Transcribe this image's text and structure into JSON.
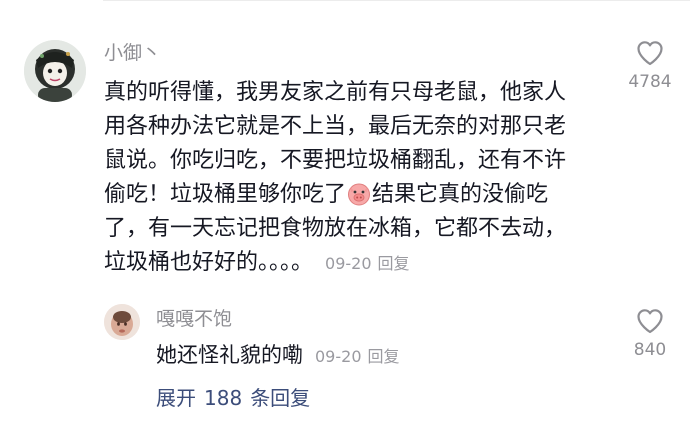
{
  "main_comment": {
    "username": "小御丶",
    "lines": [
      "真的听得懂，我男友家之前有只母老鼠，他家人",
      "用各种办法它就是不上当，最后无奈的对那只老",
      "鼠说。你吃归吃，不要把垃圾桶翻乱，还有不许",
      "偷吃！垃圾桶里够你吃了",
      "了，有一天忘记把食物放在冰箱，它都不去动，",
      "垃圾桶也好好的。。。。"
    ],
    "line4_after_emoji": "结果它真的没偷吃",
    "emoji": "pig-face-icon",
    "date": "09-20",
    "reply_label": "回复",
    "like_count": "4784"
  },
  "reply_comment": {
    "username": "嘎嘎不饱",
    "text": "她还怪礼貌的嘞",
    "date": "09-20",
    "reply_label": "回复",
    "like_count": "840"
  },
  "expand": {
    "prefix": "展开",
    "count": "188",
    "suffix": "条回复"
  },
  "colors": {
    "text": "#161823",
    "meta": "#9a9aa0",
    "username": "#8e8e93",
    "expand_link": "#3c4d7a"
  }
}
